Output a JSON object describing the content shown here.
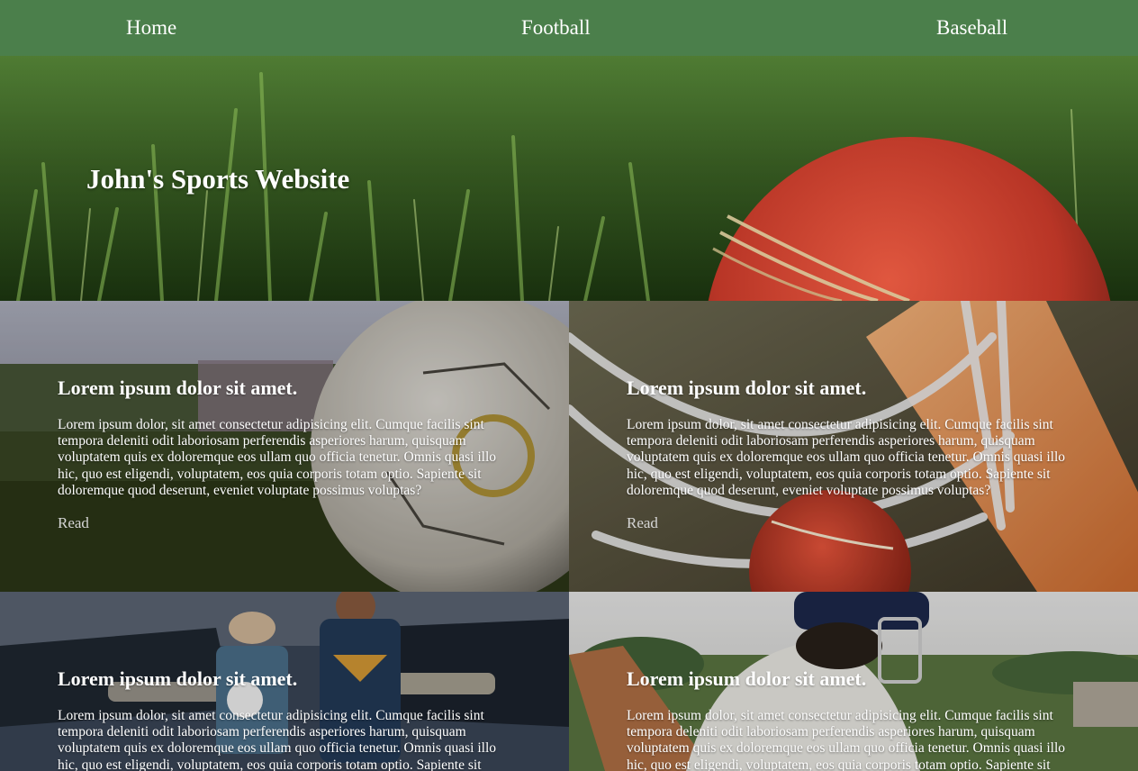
{
  "nav": {
    "items": [
      {
        "label": "Home"
      },
      {
        "label": "Football"
      },
      {
        "label": "Baseball"
      }
    ],
    "background": "#4b7f4b"
  },
  "hero": {
    "title": "John's Sports Website"
  },
  "cards": [
    {
      "title": "Lorem ipsum dolor sit amet.",
      "text": "Lorem ipsum dolor, sit amet consectetur adipisicing elit. Cumque facilis sint tempora deleniti odit laboriosam perferendis asperiores harum, quisquam voluptatem quis ex doloremque eos ullam quo officia tenetur. Omnis quasi illo hic, quo est eligendi, voluptatem, eos quia corporis totam optio. Sapiente sit doloremque quod deserunt, eveniet voluptate possimus voluptas?",
      "read_label": "Read"
    },
    {
      "title": "Lorem ipsum dolor sit amet.",
      "text": "Lorem ipsum dolor, sit amet consectetur adipisicing elit. Cumque facilis sint tempora deleniti odit laboriosam perferendis asperiores harum, quisquam voluptatem quis ex doloremque eos ullam quo officia tenetur. Omnis quasi illo hic, quo est eligendi, voluptatem, eos quia corporis totam optio. Sapiente sit doloremque quod deserunt, eveniet voluptate possimus voluptas?",
      "read_label": "Read"
    },
    {
      "title": "Lorem ipsum dolor sit amet.",
      "text": "Lorem ipsum dolor, sit amet consectetur adipisicing elit. Cumque facilis sint tempora deleniti odit laboriosam perferendis asperiores harum, quisquam voluptatem quis ex doloremque eos ullam quo officia tenetur. Omnis quasi illo hic, quo est eligendi, voluptatem, eos quia corporis totam optio. Sapiente sit"
    },
    {
      "title": "Lorem ipsum dolor sit amet.",
      "text": "Lorem ipsum dolor, sit amet consectetur adipisicing elit. Cumque facilis sint tempora deleniti odit laboriosam perferendis asperiores harum, quisquam voluptatem quis ex doloremque eos ullam quo officia tenetur. Omnis quasi illo hic, quo est eligendi, voluptatem, eos quia corporis totam optio. Sapiente sit"
    }
  ]
}
